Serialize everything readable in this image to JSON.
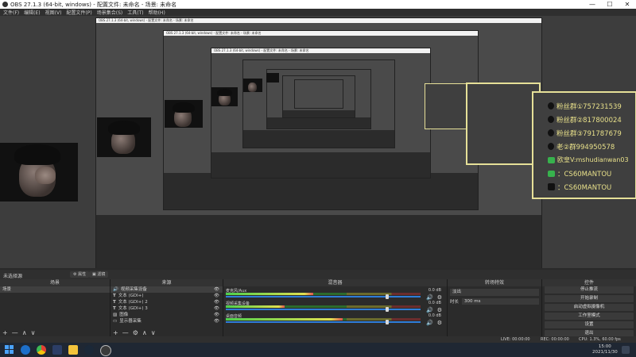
{
  "window": {
    "title": "OBS 27.1.3 (64-bit, windows) - 配置文件: 未命名 - 场景: 未命名",
    "minimize": "—",
    "maximize": "☐",
    "close": "✕"
  },
  "menu": [
    "文件(F)",
    "编辑(E)",
    "视图(V)",
    "配置文件(P)",
    "场景集合(S)",
    "工具(T)",
    "帮助(H)"
  ],
  "qq_panel": {
    "lines": [
      {
        "icon": "qq",
        "text": "粉丝群①757231539"
      },
      {
        "icon": "qq",
        "text": "粉丝群②817800024"
      },
      {
        "icon": "qq",
        "text": "粉丝群③791787679"
      },
      {
        "icon": "qq",
        "text": "老②群994950578"
      },
      {
        "icon": "wechat",
        "text": "欧皇V:mshudianwan03"
      },
      {
        "icon": "wechat",
        "text": "：CS60MANTOU"
      },
      {
        "icon": "tiktok",
        "text": "：CS60MANTOU"
      }
    ]
  },
  "scene_bar": {
    "label": "未选择源",
    "properties": "属性",
    "filters": "滤镜"
  },
  "scenes_panel": {
    "header": "场景",
    "items": [
      "场景"
    ],
    "footer": [
      "+",
      "—",
      "∧",
      "∨"
    ]
  },
  "sources_panel": {
    "header": "来源",
    "items": [
      {
        "icon": "speaker-icon",
        "label": "视频采集设备"
      },
      {
        "icon": "text-icon",
        "label": "文本 (GDI+)"
      },
      {
        "icon": "text-icon",
        "label": "文本 (GDI+) 2"
      },
      {
        "icon": "text-icon",
        "label": "文本 (GDI+) 3"
      },
      {
        "icon": "image-icon",
        "label": "图像"
      },
      {
        "icon": "monitor-icon",
        "label": "显示器采集"
      }
    ],
    "footer": [
      "+",
      "—",
      "⚙",
      "∧",
      "∨"
    ]
  },
  "mixer_panel": {
    "header": "混音器",
    "channels": [
      {
        "name": "麦克风/Aux",
        "db": "0.0 dB",
        "level": 0.45,
        "volume": 0.82
      },
      {
        "name": "视频采集设备",
        "db": "0.0 dB",
        "level": 0.3,
        "volume": 0.82
      },
      {
        "name": "桌面音频",
        "db": "0.0 dB",
        "level": 0.6,
        "volume": 0.82
      }
    ]
  },
  "transitions_panel": {
    "header": "转场特效",
    "type": "淡出",
    "duration_label": "时长",
    "duration": "300 ms"
  },
  "controls_panel": {
    "header": "控件",
    "buttons": [
      "停止推流",
      "开始录制",
      "启动虚拟摄像机",
      "工作室模式",
      "设置",
      "退出"
    ]
  },
  "status": {
    "live": "LIVE: 00:00:00",
    "rec": "REC: 00:00:00",
    "cpu": "CPU: 1.3%, 60.00 fps"
  },
  "taskbar": {
    "time": "15:00",
    "date": "2021/11/30"
  },
  "colors": {
    "qq_text": "#e8e08a",
    "qq_border": "#e6e098",
    "accent": "#2f7dd8"
  }
}
